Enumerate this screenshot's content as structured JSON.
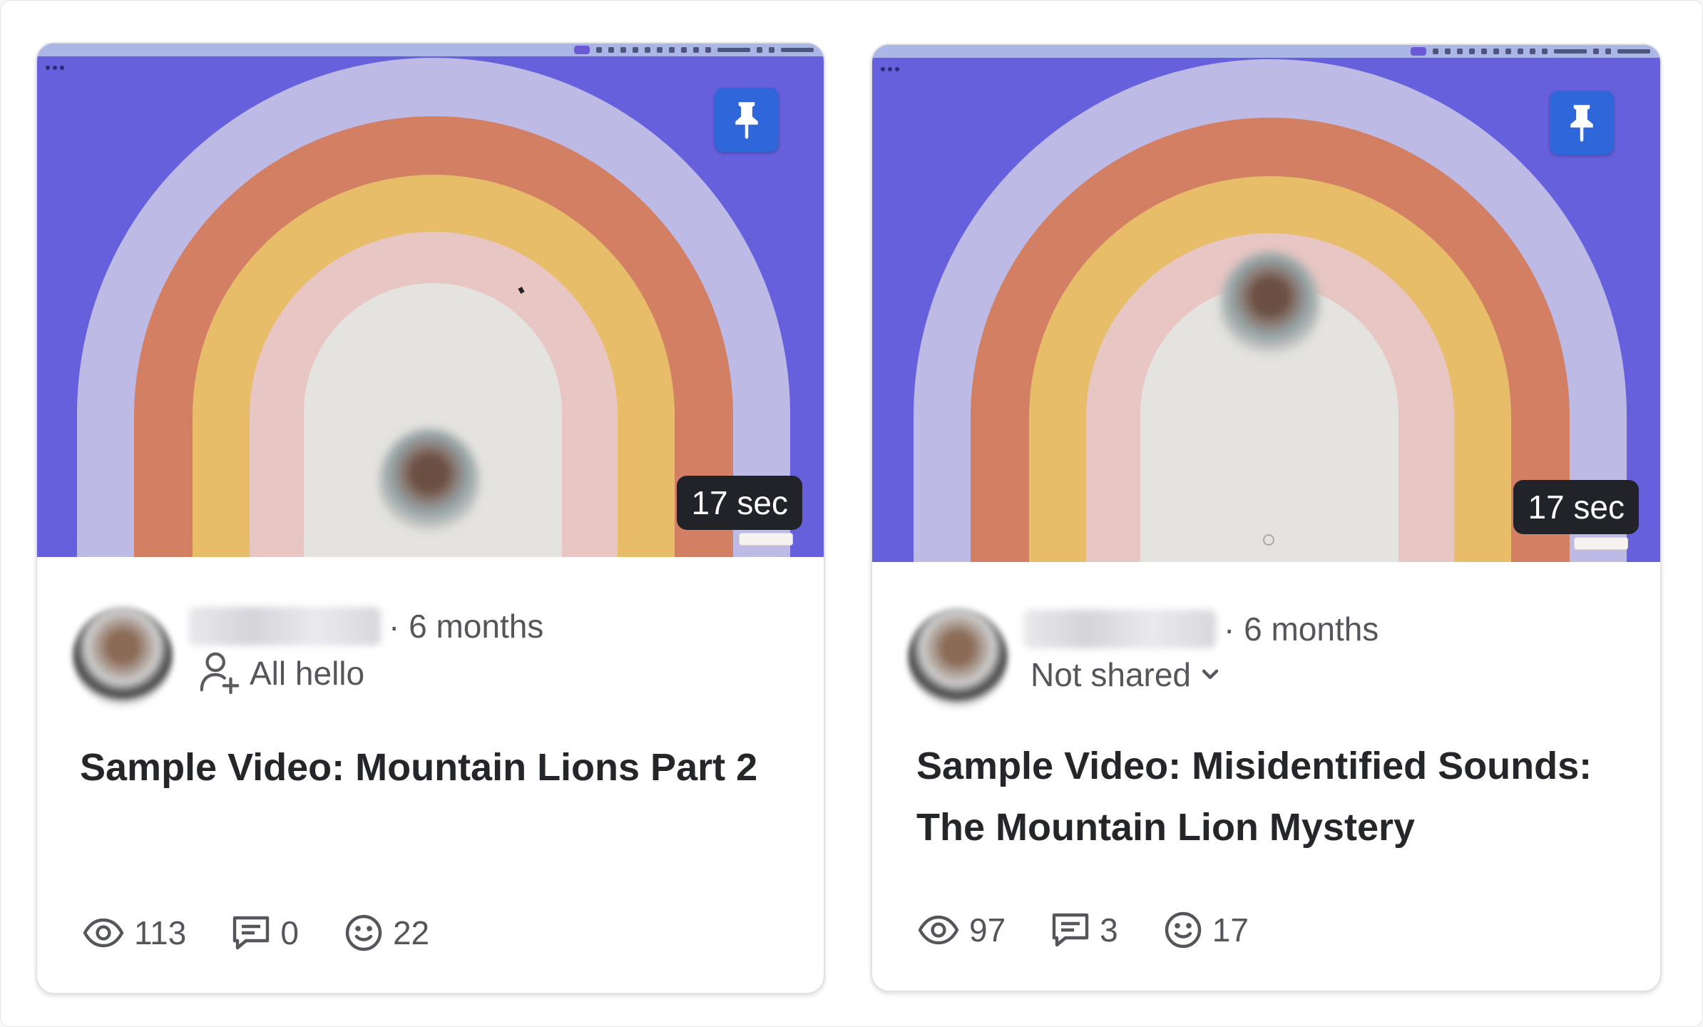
{
  "cards": [
    {
      "duration": "17 sec",
      "age": "· 6 months",
      "share": "All hello",
      "title": "Sample Video: Mountain Lions Part 2",
      "stats": {
        "views": "113",
        "comments": "0",
        "reactions": "22"
      }
    },
    {
      "duration": "17 sec",
      "age": "· 6 months",
      "share": "Not shared",
      "title_line1": "Sample Video: Misidentified Sounds:",
      "title_line2": "The Mountain Lion Mystery",
      "stats": {
        "views": "97",
        "comments": "3",
        "reactions": "17"
      }
    }
  ],
  "colors": {
    "thumbnail_background": "#6660dc",
    "rainbow": [
      "#bdbae6",
      "#d27f63",
      "#e7bd6a",
      "#e8c6c3",
      "#e4e3df"
    ],
    "pin_button": "#2f67db",
    "duration_badge": "#222328"
  },
  "icons": [
    "pin-icon",
    "person-add-icon",
    "chevron-down-icon",
    "eye-icon",
    "comment-icon",
    "smiley-icon"
  ]
}
